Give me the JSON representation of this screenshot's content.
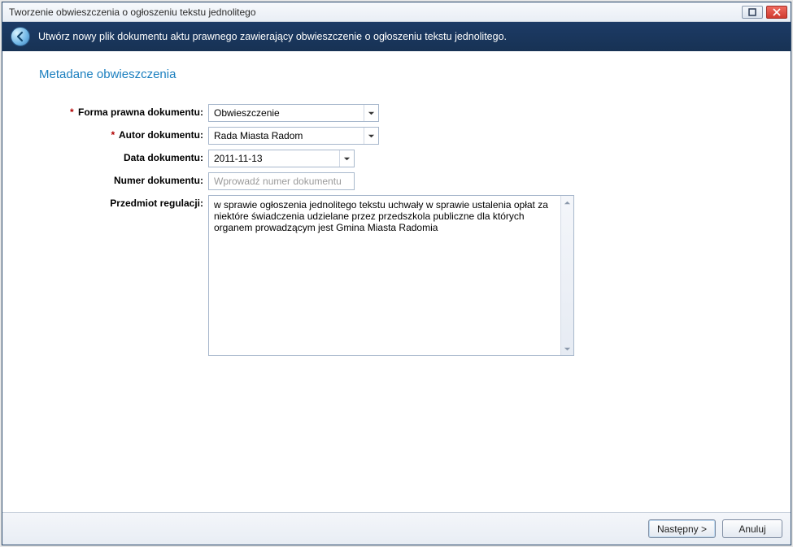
{
  "window": {
    "title": "Tworzenie obwieszczenia o ogłoszeniu tekstu jednolitego"
  },
  "banner": {
    "text": "Utwórz nowy plik dokumentu aktu prawnego zawierający obwieszczenie o ogłoszeniu tekstu jednolitego."
  },
  "section_title": "Metadane obwieszczenia",
  "form": {
    "legal_form": {
      "label": "Forma prawna dokumentu:",
      "value": "Obwieszczenie",
      "required": true
    },
    "author": {
      "label": "Autor dokumentu:",
      "value": "Rada Miasta Radom",
      "required": true
    },
    "date": {
      "label": "Data dokumentu:",
      "value": "2011-11-13",
      "required": false
    },
    "number": {
      "label": "Numer dokumentu:",
      "placeholder": "Wprowadź numer dokumentu",
      "value": "",
      "required": false
    },
    "subject": {
      "label": "Przedmiot regulacji:",
      "value": "w sprawie ogłoszenia jednolitego tekstu uchwały w sprawie ustalenia opłat za niektóre świadczenia udzielane przez przedszkola publiczne dla których organem prowadzącym jest Gmina Miasta Radomia",
      "required": false
    }
  },
  "buttons": {
    "next": "Następny >",
    "cancel": "Anuluj"
  },
  "required_marker": "*"
}
